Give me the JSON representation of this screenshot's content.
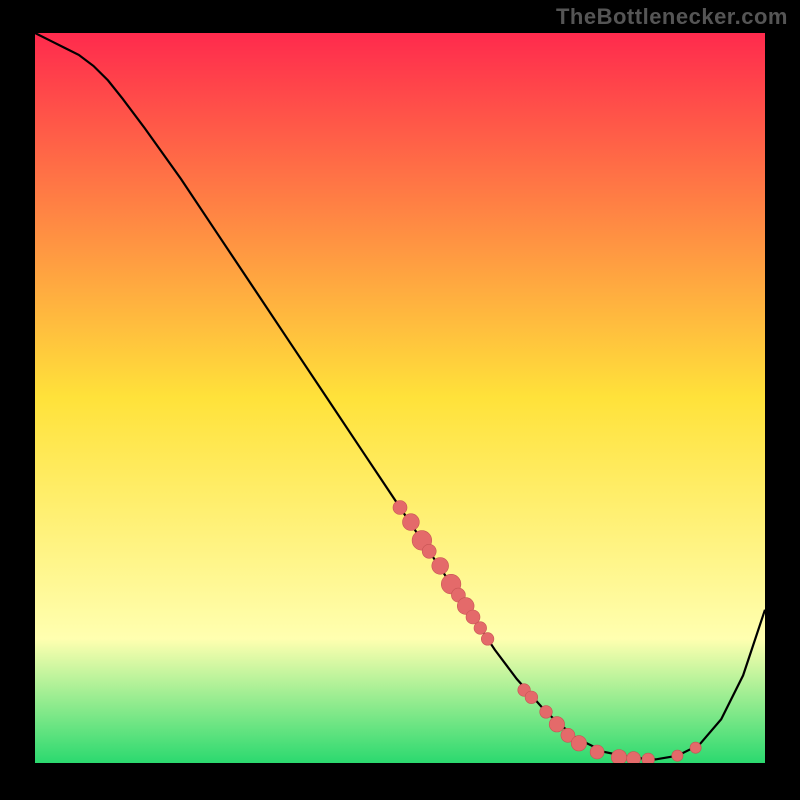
{
  "watermark": "TheBottlenecker.com",
  "colors": {
    "bg_black": "#000000",
    "grad_top": "#ff2a4d",
    "grad_mid": "#ffe23a",
    "grad_low": "#ffffb0",
    "grad_bottom": "#2bd96f",
    "curve": "#000000",
    "marker": "#e46a6a",
    "marker_edge": "#c75454"
  },
  "chart_data": {
    "type": "line",
    "title": "",
    "xlabel": "",
    "ylabel": "",
    "xlim": [
      0,
      100
    ],
    "ylim": [
      0,
      100
    ],
    "series": [
      {
        "name": "curve",
        "x": [
          0,
          2,
          4,
          6,
          8,
          10,
          12,
          15,
          20,
          25,
          30,
          35,
          40,
          45,
          50,
          55,
          60,
          63,
          66,
          70,
          74,
          78,
          82,
          85,
          88,
          91,
          94,
          97,
          100
        ],
        "y": [
          100,
          99,
          98,
          97,
          95.5,
          93.5,
          91,
          87,
          80,
          72.5,
          65,
          57.5,
          50,
          42.5,
          35,
          27.5,
          20,
          15.5,
          11.5,
          7,
          3.5,
          1.5,
          0.7,
          0.5,
          1,
          2.5,
          6,
          12,
          21
        ]
      }
    ],
    "markers": [
      {
        "x": 50,
        "y": 35,
        "r": 1.0
      },
      {
        "x": 51.5,
        "y": 33,
        "r": 1.2
      },
      {
        "x": 53,
        "y": 30.5,
        "r": 1.4
      },
      {
        "x": 54,
        "y": 29,
        "r": 1.0
      },
      {
        "x": 55.5,
        "y": 27,
        "r": 1.2
      },
      {
        "x": 57,
        "y": 24.5,
        "r": 1.4
      },
      {
        "x": 58,
        "y": 23,
        "r": 1.0
      },
      {
        "x": 59,
        "y": 21.5,
        "r": 1.2
      },
      {
        "x": 60,
        "y": 20,
        "r": 1.0
      },
      {
        "x": 61,
        "y": 18.5,
        "r": 0.9
      },
      {
        "x": 62,
        "y": 17,
        "r": 0.9
      },
      {
        "x": 67,
        "y": 10,
        "r": 0.9
      },
      {
        "x": 68,
        "y": 9,
        "r": 0.9
      },
      {
        "x": 70,
        "y": 7,
        "r": 0.9
      },
      {
        "x": 71.5,
        "y": 5.3,
        "r": 1.1
      },
      {
        "x": 73,
        "y": 3.8,
        "r": 1.0
      },
      {
        "x": 74.5,
        "y": 2.7,
        "r": 1.1
      },
      {
        "x": 77,
        "y": 1.5,
        "r": 1.0
      },
      {
        "x": 80,
        "y": 0.8,
        "r": 1.1
      },
      {
        "x": 82,
        "y": 0.6,
        "r": 1.0
      },
      {
        "x": 84,
        "y": 0.5,
        "r": 0.9
      },
      {
        "x": 88,
        "y": 1.0,
        "r": 0.8
      },
      {
        "x": 90.5,
        "y": 2.1,
        "r": 0.8
      }
    ]
  }
}
